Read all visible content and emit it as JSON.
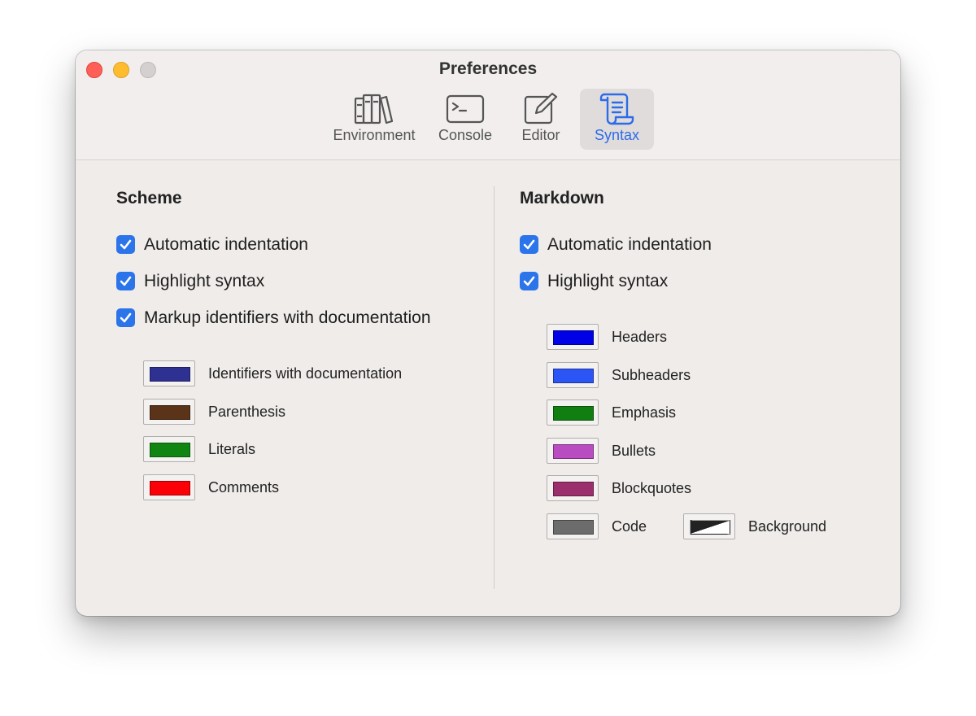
{
  "window": {
    "title": "Preferences"
  },
  "toolbar": {
    "tabs": [
      {
        "label": "Environment",
        "icon": "books-icon",
        "active": false
      },
      {
        "label": "Console",
        "icon": "terminal-icon",
        "active": false
      },
      {
        "label": "Editor",
        "icon": "compose-icon",
        "active": false
      },
      {
        "label": "Syntax",
        "icon": "scroll-icon",
        "active": true
      }
    ]
  },
  "scheme": {
    "title": "Scheme",
    "options": [
      {
        "label": "Automatic indentation",
        "checked": true
      },
      {
        "label": "Highlight syntax",
        "checked": true
      },
      {
        "label": "Markup identifiers with documentation",
        "checked": true
      }
    ],
    "colors": [
      {
        "label": "Identifiers with documentation",
        "color": "#2e3192"
      },
      {
        "label": "Parenthesis",
        "color": "#5a3318"
      },
      {
        "label": "Literals",
        "color": "#118511"
      },
      {
        "label": "Comments",
        "color": "#fb0007"
      }
    ]
  },
  "markdown": {
    "title": "Markdown",
    "options": [
      {
        "label": "Automatic indentation",
        "checked": true
      },
      {
        "label": "Highlight syntax",
        "checked": true
      }
    ],
    "colors": [
      {
        "label": "Headers",
        "color": "#0000e6"
      },
      {
        "label": "Subheaders",
        "color": "#2c55f6"
      },
      {
        "label": "Emphasis",
        "color": "#107e10"
      },
      {
        "label": "Bullets",
        "color": "#b94cc0"
      },
      {
        "label": "Blockquotes",
        "color": "#9b2e6c"
      },
      {
        "label": "Code",
        "color": "#6c6c6c"
      }
    ],
    "background": {
      "label": "Background",
      "color_dark": "#222222",
      "color_light": "#ffffff"
    }
  }
}
